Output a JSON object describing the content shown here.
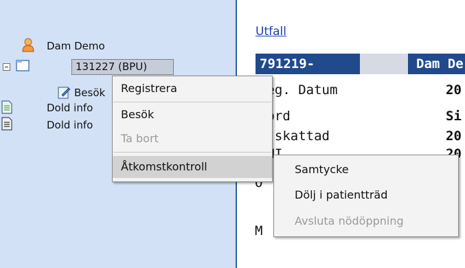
{
  "tree": {
    "patient_name": "Dam Demo",
    "selected_node": "131227 (BPU)",
    "visit_node": "Besök",
    "hidden_nodes": [
      "Dold info",
      "Dold info"
    ]
  },
  "main": {
    "outcome_link": "Utfall",
    "patient_id": "791219-",
    "patient_name_fragment": "Dam De",
    "rows": [
      {
        "label": "Reg. Datum",
        "value": "20"
      },
      {
        "label": "Hörd",
        "value": "Si"
      },
      {
        "label": "P skattad",
        "value": "20"
      },
      {
        "label": "PNI",
        "value": "20"
      }
    ],
    "partial_lines": [
      "O",
      "M"
    ]
  },
  "context_menu": {
    "items": [
      {
        "label": "Registrera",
        "enabled": true
      },
      {
        "label": "Besök",
        "enabled": true
      },
      {
        "label": "Ta bort",
        "enabled": false
      },
      {
        "label": "Åtkomstkontroll",
        "enabled": true,
        "has_submenu": true
      }
    ]
  },
  "submenu": {
    "items": [
      {
        "label": "Samtycke",
        "enabled": true
      },
      {
        "label": "Dölj i patientträd",
        "enabled": true
      },
      {
        "label": "Avsluta nödöppning",
        "enabled": false
      }
    ]
  },
  "colors": {
    "tree_background": "#d3e1f6",
    "header_background": "#204a8c",
    "link": "#1a3fb8",
    "disabled_text": "#9a9a9a"
  }
}
